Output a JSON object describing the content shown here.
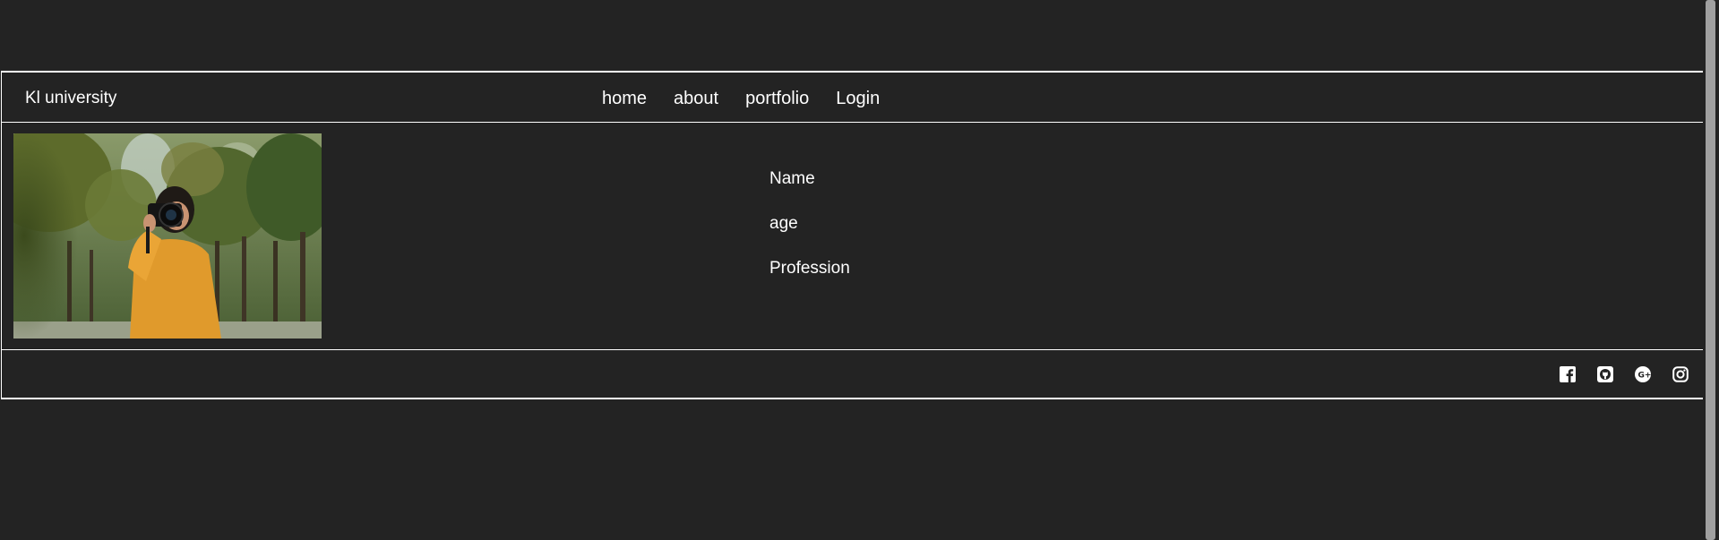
{
  "header": {
    "brand": "Kl university",
    "nav": [
      {
        "label": "home"
      },
      {
        "label": "about"
      },
      {
        "label": "portfolio"
      },
      {
        "label": "Login"
      }
    ]
  },
  "profile": {
    "photo_subject": "woman-with-camera",
    "fields": [
      {
        "label": "Name"
      },
      {
        "label": "age"
      },
      {
        "label": "Profession"
      }
    ]
  },
  "footer": {
    "social": [
      {
        "icon": "facebook-icon"
      },
      {
        "icon": "github-icon"
      },
      {
        "icon": "google-plus-icon"
      },
      {
        "icon": "instagram-icon"
      }
    ]
  },
  "colors": {
    "background": "#232323",
    "text": "#ffffff",
    "border": "#ffffff"
  }
}
